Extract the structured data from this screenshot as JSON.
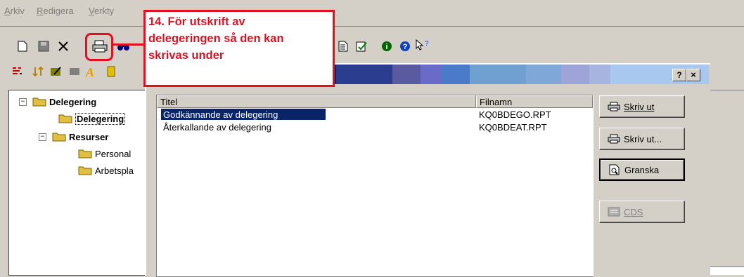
{
  "menu": {
    "items": [
      "Arkiv",
      "Redigera",
      "Verkty"
    ]
  },
  "callout": {
    "lines": [
      "14. För utskrift av",
      "delegeringen så den kan",
      "skrivas under"
    ]
  },
  "tree": {
    "items": [
      {
        "label": "Delegering",
        "bold": true,
        "expander": "−"
      },
      {
        "label": "Delegering",
        "bold": true
      },
      {
        "label": "Resurser",
        "bold": true,
        "expander": "−"
      },
      {
        "label": "Personal",
        "bold": false
      },
      {
        "label": "Arbetspla",
        "bold": false
      }
    ]
  },
  "dialog": {
    "title_buttons": [
      "?",
      "×"
    ],
    "columns": [
      "Titel",
      "Filnamn"
    ],
    "rows": [
      {
        "title": "Godkännande av delegering",
        "file": "KQ0BDEGO.RPT",
        "selected": true
      },
      {
        "title": "Återkallande av delegering",
        "file": "KQ0BDEAT.RPT",
        "selected": false
      }
    ],
    "buttons": {
      "print": "Skriv ut",
      "print_dialog": "Skriv ut...",
      "preview": "Granska",
      "cds": "CDS"
    }
  },
  "colors": {
    "accent": "#e01020",
    "selection": "#0a246a"
  }
}
